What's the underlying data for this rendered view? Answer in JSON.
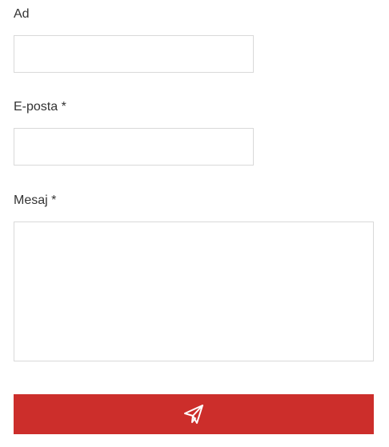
{
  "form": {
    "name": {
      "label": "Ad",
      "value": "",
      "placeholder": ""
    },
    "email": {
      "label": "E-posta *",
      "value": "",
      "placeholder": ""
    },
    "message": {
      "label": "Mesaj *",
      "value": "",
      "placeholder": ""
    },
    "submit": {
      "icon": "paper-plane-icon",
      "color": "#cc2e2b"
    }
  }
}
